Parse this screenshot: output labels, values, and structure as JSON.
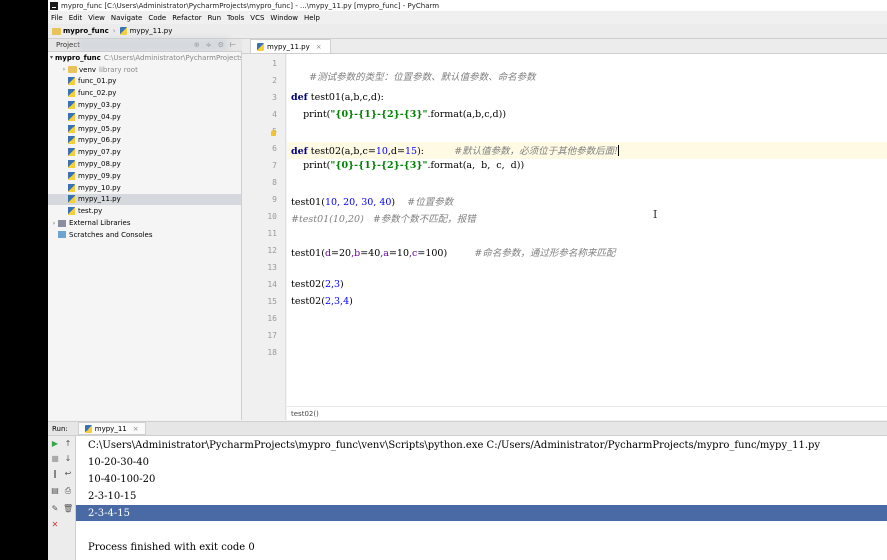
{
  "window": {
    "title": "mypro_func [C:\\Users\\Administrator\\PycharmProjects\\mypro_func] - ...\\mypy_11.py [mypro_func] - PyCharm"
  },
  "menu": [
    "File",
    "Edit",
    "View",
    "Navigate",
    "Code",
    "Refactor",
    "Run",
    "Tools",
    "VCS",
    "Window",
    "Help"
  ],
  "nav": {
    "project": "mypro_func",
    "file": "mypy_11.py"
  },
  "project_panel": {
    "title": "Project",
    "root_name": "mypro_func",
    "root_path": "C:\\Users\\Administrator\\PycharmProjects\\mypro_func",
    "venv_name": "venv",
    "venv_note": "library root",
    "files": [
      "func_01.py",
      "func_02.py",
      "mypy_03.py",
      "mypy_04.py",
      "mypy_05.py",
      "mypy_06.py",
      "mypy_07.py",
      "mypy_08.py",
      "mypy_09.py",
      "mypy_10.py",
      "mypy_11.py",
      "test.py"
    ],
    "selected_file": "mypy_11.py",
    "external_libraries": "External Libraries",
    "scratches": "Scratches and Consoles"
  },
  "editor": {
    "tab_label": "mypy_11.py",
    "line_numbers": [
      "1",
      "2",
      "3",
      "4",
      "5",
      "6",
      "7",
      "8",
      "9",
      "10",
      "11",
      "12",
      "13",
      "14",
      "15",
      "16",
      "17",
      "18"
    ],
    "code": {
      "l1_comment": "#测试参数的类型：位置参数、默认值参数、命名参数",
      "l3_def": "def",
      "l3_name": " test01",
      "l3_sig": "(a,b,c,d):",
      "l4_print": "    print(",
      "l4_str": "\"{0}-{1}-{2}-{3}\"",
      "l4_rest": ".format(a,b,c,d))",
      "l6_def": "def",
      "l6_name": " test02",
      "l6_sig_a": "(a,b,c=",
      "l6_num1": "10",
      "l6_sig_b": ",d=",
      "l6_num2": "15",
      "l6_sig_c": "):",
      "l6_comment": "#默认值参数，必须位于其他参数后面!",
      "l7_print": "    print(",
      "l7_str": "\"{0}-{1}-{2}-{3}\"",
      "l7_rest": ".format(a,  b,  c,  d))",
      "l9_call": "test01(",
      "l9_args": "10, 20, 30, 40",
      "l9_close": ")",
      "l9_comment": "#位置参数",
      "l10_comment": "#test01(10,20)   #参数个数不匹配，报错",
      "l12_call": "test01(",
      "l12_p1": "d",
      "l12_v1": "=20",
      "l12_p2": ",b",
      "l12_v2": "=40",
      "l12_p3": ",a",
      "l12_v3": "=10",
      "l12_p4": ",c",
      "l12_v4": "=100",
      "l12_close": ")",
      "l12_comment": "#命名参数，通过形参名称来匹配",
      "l14_call": "test02(",
      "l14_args": "2,3",
      "l14_close": ")",
      "l15_call": "test02(",
      "l15_args": "2,3,4",
      "l15_close": ")"
    },
    "breadcrumb": "test02()"
  },
  "run": {
    "label": "Run:",
    "config": "mypy_11",
    "command": "C:\\Users\\Administrator\\PycharmProjects\\mypro_func\\venv\\Scripts\\python.exe C:/Users/Administrator/PycharmProjects/mypro_func/mypy_11.py",
    "output": [
      "10-20-30-40",
      "10-40-100-20",
      "2-3-10-15",
      "2-3-4-15"
    ],
    "selected_output": "2-3-4-15",
    "finished": "Process finished with exit code 0"
  },
  "colors": {
    "keyword": "#000080",
    "string": "#008000",
    "number": "#0000ff",
    "comment": "#808080",
    "selection": "#4a6aa5",
    "current_line": "#fffae3"
  }
}
